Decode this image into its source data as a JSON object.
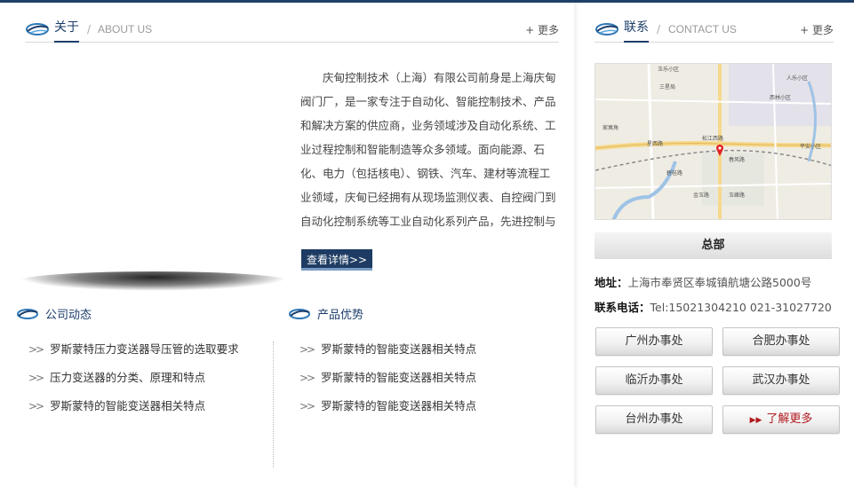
{
  "about": {
    "title_cn": "关于",
    "title_en": "ABOUT US",
    "more": "+ 更多",
    "text": "庆甸控制技术（上海）有限公司前身是上海庆甸阀门厂，是一家专注于自动化、智能控制技术、产品和解决方案的供应商，业务领域涉及自动化系统、工业过程控制和智能制造等众多领域。面向能源、石化、电力（包括核电）、钢铁、汽车、建材等流程工业领域，庆甸已经拥有从现场监测仪表、自控阀门到自动化控制系统等工业自动化系列产品，先进控制与优",
    "detail_button": "查看详情>>"
  },
  "news": {
    "title": "公司动态",
    "items": [
      "罗斯蒙特压力变送器导压管的选取要求",
      "压力变送器的分类、原理和特点",
      "罗斯蒙特的智能变送器相关特点"
    ]
  },
  "advantages": {
    "title": "产品优势",
    "items": [
      "罗斯蒙特的智能变送器相关特点",
      "罗斯蒙特的智能变送器相关特点",
      "罗斯蒙特的智能变送器相关特点"
    ]
  },
  "contact": {
    "title_cn": "联系",
    "title_en": "CONTACT US",
    "more": "+ 更多",
    "map_labels": [
      "玉乐小区",
      "人乐小区",
      "三星局",
      "西林小区",
      "家寓角",
      "星西路",
      "松江西路",
      "春风路",
      "碧桂路",
      "金玉路",
      "玉峰路",
      "平安小区"
    ],
    "hq_label": "总部",
    "address_label": "地址：",
    "address_value": "上海市奉贤区奉城镇航塘公路5000号",
    "tel_label": "联系电话：",
    "tel_value": "Tel:15021304210 021-31027720",
    "offices": [
      "广州办事处",
      "合肥办事处",
      "临沂办事处",
      "武汉办事处",
      "台州办事处"
    ],
    "more_button": "了解更多"
  },
  "colors": {
    "primary": "#1e3c63",
    "accent_red": "#b0191e"
  }
}
